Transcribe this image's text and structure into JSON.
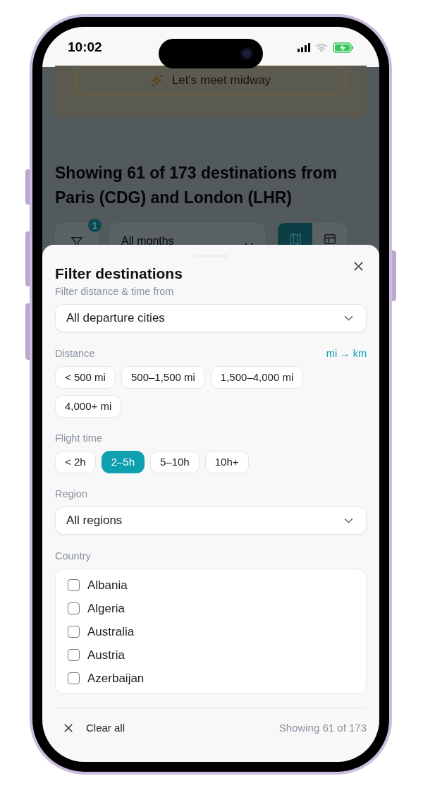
{
  "status_bar": {
    "time": "10:02"
  },
  "background": {
    "midway_button": "Let's meet midway",
    "heading": "Showing 61 of 173 destinations from Paris (CDG) and London (LHR)",
    "filter_badge": "1",
    "month_select": "All months",
    "view_toggle": [
      {
        "kind": "map",
        "selected": true
      },
      {
        "kind": "table",
        "selected": false
      }
    ]
  },
  "sheet": {
    "title": "Filter destinations",
    "departure": {
      "label": "Filter distance & time from",
      "value": "All departure cities"
    },
    "distance": {
      "label": "Distance",
      "unit_toggle": "mi → km",
      "options": [
        {
          "label": "< 500 mi",
          "selected": false
        },
        {
          "label": "500–1,500 mi",
          "selected": false
        },
        {
          "label": "1,500–4,000 mi",
          "selected": false
        },
        {
          "label": "4,000+ mi",
          "selected": false
        }
      ]
    },
    "flight_time": {
      "label": "Flight time",
      "options": [
        {
          "label": "< 2h",
          "selected": false
        },
        {
          "label": "2–5h",
          "selected": true
        },
        {
          "label": "5–10h",
          "selected": false
        },
        {
          "label": "10h+",
          "selected": false
        }
      ]
    },
    "region": {
      "label": "Region",
      "value": "All regions"
    },
    "country": {
      "label": "Country",
      "options": [
        {
          "label": "Albania",
          "checked": false
        },
        {
          "label": "Algeria",
          "checked": false
        },
        {
          "label": "Australia",
          "checked": false
        },
        {
          "label": "Austria",
          "checked": false
        },
        {
          "label": "Azerbaijan",
          "checked": false
        }
      ]
    },
    "footer": {
      "clear": "Clear all",
      "count": "Showing 61 of 173"
    }
  }
}
